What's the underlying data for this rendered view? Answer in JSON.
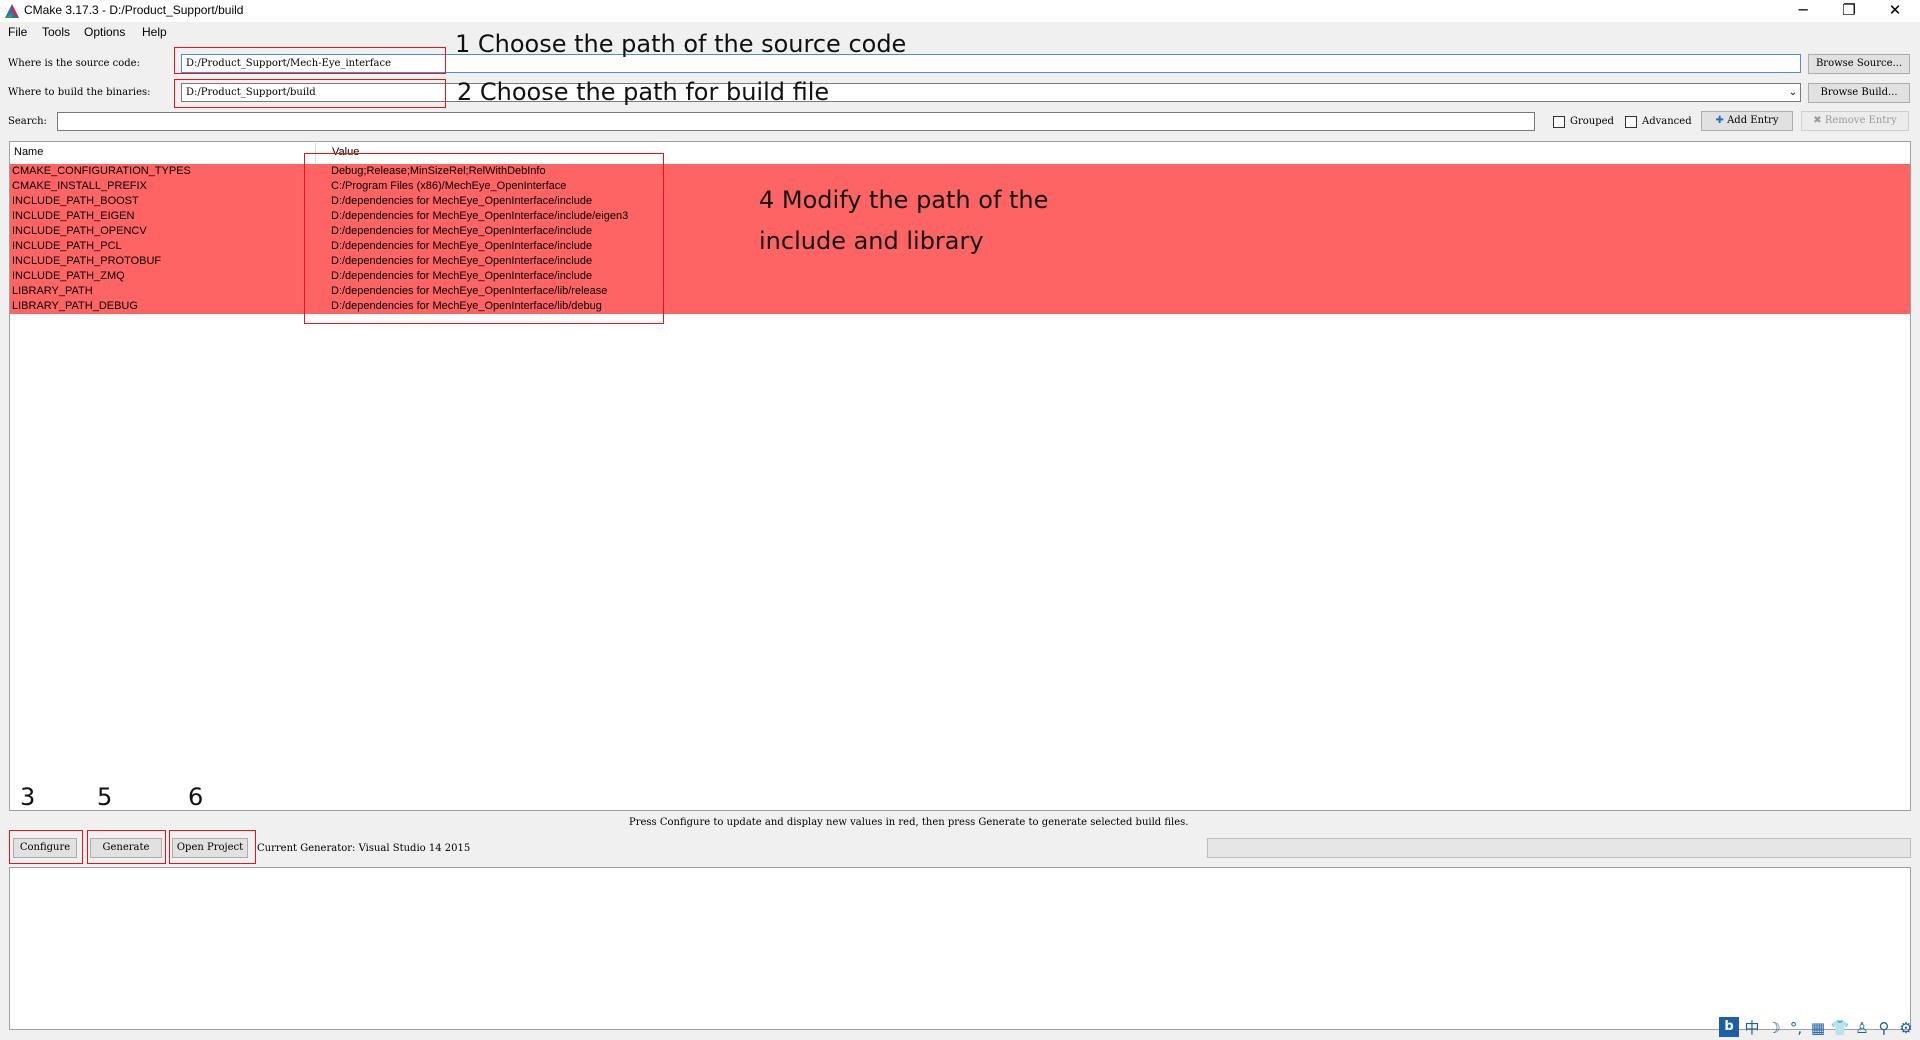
{
  "window": {
    "title": "CMake 3.17.3 - D:/Product_Support/build",
    "controls": {
      "minimize": "─",
      "restore": "❐",
      "close": "✕"
    }
  },
  "menu": [
    "File",
    "Tools",
    "Options",
    "Help"
  ],
  "source": {
    "label": "Where is the source code:",
    "value": "D:/Product_Support/Mech-Eye_interface",
    "browse_label": "Browse Source..."
  },
  "build": {
    "label": "Where to build the binaries:",
    "value": "D:/Product_Support/build",
    "browse_label": "Browse Build..."
  },
  "search": {
    "label": "Search:",
    "value": "",
    "grouped_label": "Grouped",
    "advanced_label": "Advanced",
    "add_entry_label": "Add Entry",
    "remove_entry_label": "Remove Entry"
  },
  "table": {
    "headers": {
      "name": "Name",
      "value": "Value"
    },
    "highlight_color": "#ff6464",
    "rows": [
      {
        "name": "CMAKE_CONFIGURATION_TYPES",
        "value": "Debug;Release;MinSizeRel;RelWithDebInfo"
      },
      {
        "name": "CMAKE_INSTALL_PREFIX",
        "value": "C:/Program Files (x86)/MechEye_OpenInterface"
      },
      {
        "name": "INCLUDE_PATH_BOOST",
        "value": "D:/dependencies for MechEye_OpenInterface/include"
      },
      {
        "name": "INCLUDE_PATH_EIGEN",
        "value": "D:/dependencies for MechEye_OpenInterface/include/eigen3"
      },
      {
        "name": "INCLUDE_PATH_OPENCV",
        "value": "D:/dependencies for MechEye_OpenInterface/include"
      },
      {
        "name": "INCLUDE_PATH_PCL",
        "value": "D:/dependencies for MechEye_OpenInterface/include"
      },
      {
        "name": "INCLUDE_PATH_PROTOBUF",
        "value": "D:/dependencies for MechEye_OpenInterface/include"
      },
      {
        "name": "INCLUDE_PATH_ZMQ",
        "value": "D:/dependencies for MechEye_OpenInterface/include"
      },
      {
        "name": "LIBRARY_PATH",
        "value": "D:/dependencies for MechEye_OpenInterface/lib/release"
      },
      {
        "name": "LIBRARY_PATH_DEBUG",
        "value": "D:/dependencies for MechEye_OpenInterface/lib/debug"
      }
    ]
  },
  "annotations": {
    "step1": "1 Choose  the path of the source code",
    "step2": "2 Choose the path for build file",
    "step3": "3",
    "step4_line1": "4 Modify the path of the",
    "step4_line2": "include and library",
    "step5": "5",
    "step6": "6",
    "box_color": "#e8141b"
  },
  "hint": "Press Configure to update and display new values in red, then press Generate to generate selected build files.",
  "actions": {
    "configure_label": "Configure",
    "generate_label": "Generate",
    "open_project_label": "Open Project",
    "generator_text": "Current Generator: Visual Studio 14 2015"
  },
  "tray": [
    "中",
    "☽",
    "°,",
    "▦",
    "👕",
    "♙",
    "⚲",
    "⚙"
  ]
}
